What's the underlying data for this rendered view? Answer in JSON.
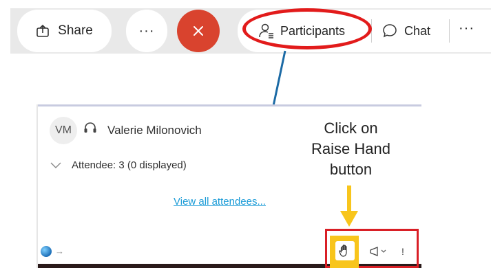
{
  "toolbar": {
    "share_label": "Share",
    "more_label": "···",
    "end_call_icon": "close-icon",
    "participants_label": "Participants",
    "chat_label": "Chat",
    "more2_label": "···"
  },
  "panel": {
    "avatar_initials": "VM",
    "presenter_name": "Valerie Milonovich",
    "attendee_count": "Attendee: 3 (0 displayed)",
    "view_all_link": "View all attendees..."
  },
  "annotation": {
    "line1": "Click on",
    "line2": "Raise Hand",
    "line3": "button"
  },
  "bottom_bar": {
    "arrow_label": "→",
    "exclaim_label": "!"
  },
  "colors": {
    "end_call": "#d9432e",
    "highlight_red": "#e21b1b",
    "arrow_blue": "#1b6aa5",
    "highlight_yellow": "#f8c51c",
    "link": "#1a9bd7"
  }
}
